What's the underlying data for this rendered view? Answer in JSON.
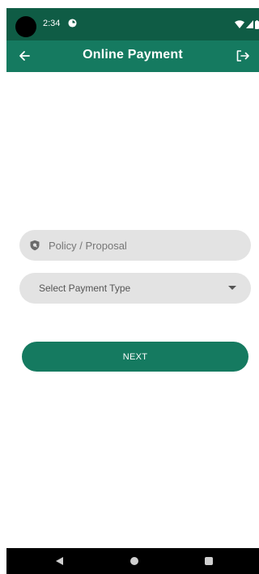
{
  "status_bar": {
    "time": "2:34",
    "icons": [
      "app-notification-icon",
      "wifi-icon",
      "signal-icon",
      "battery-icon"
    ],
    "background_color": "#0f5c45"
  },
  "app_bar": {
    "title": "Online Payment",
    "back_icon": "arrow-left-icon",
    "logout_icon": "logout-icon",
    "background_color": "#157a60"
  },
  "form": {
    "policy_field": {
      "placeholder": "Policy / Proposal",
      "value": "",
      "icon": "shield-icon"
    },
    "payment_type": {
      "selected_label": "Select Payment Type",
      "icon": "chevron-down-icon"
    },
    "next_label": "NEXT",
    "field_background": "#e3e3e3",
    "accent_color": "#157a60"
  },
  "nav_bar": {
    "icons": [
      "nav-back-icon",
      "nav-home-icon",
      "nav-recents-icon"
    ]
  }
}
